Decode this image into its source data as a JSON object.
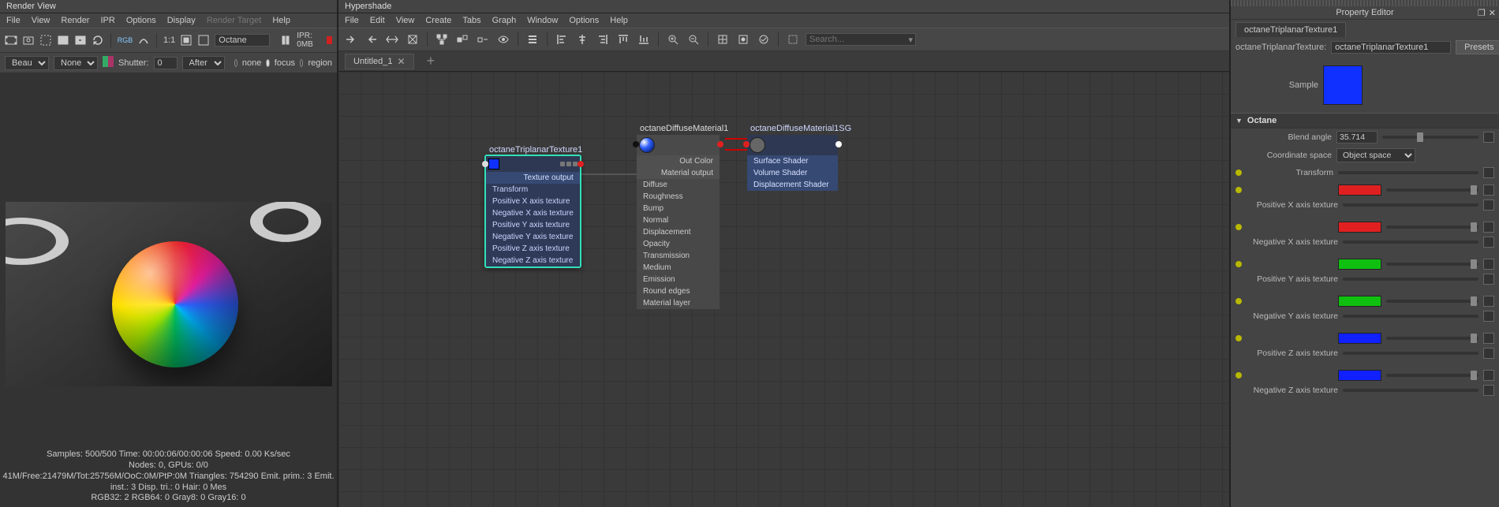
{
  "render_view": {
    "title": "Render View",
    "menus": [
      "File",
      "View",
      "Render",
      "IPR",
      "Options",
      "Display",
      "Render Target",
      "Help"
    ],
    "toolbar": {
      "ratio": "1:1",
      "renderer_field": "Octane",
      "ipr_label": "IPR: 0MB"
    },
    "subbar": {
      "layer_label": "Beauty",
      "camera_label": "None",
      "shutter_label": "Shutter:",
      "shutter_value": "0",
      "time_mode": "After",
      "radios": {
        "none": "none",
        "focus": "focus",
        "region": "region"
      }
    },
    "stats": {
      "l1": "Samples: 500/500  Time: 00:00:06/00:00:06  Speed: 0.00 Ks/sec",
      "l2": "Nodes: 0, GPUs: 0/0",
      "l3": "41M/Free:21479M/Tot:25756M/OoC:0M/PtP:0M Triangles: 754290 Emit. prim.: 3 Emit. inst.: 3 Disp. tri.: 0 Hair: 0 Mes",
      "l4": "RGB32: 2 RGB64: 0 Gray8: 0 Gray16: 0"
    }
  },
  "hypershade": {
    "title": "Hypershade",
    "menus": [
      "File",
      "Edit",
      "View",
      "Create",
      "Tabs",
      "Graph",
      "Window",
      "Options",
      "Help"
    ],
    "search_placeholder": "Search...",
    "tab": "Untitled_1",
    "nodes": {
      "triplanar": {
        "title": "octaneTriplanarTexture1",
        "out": "Texture output",
        "ins": [
          "Transform",
          "Positive X axis texture",
          "Negative X axis texture",
          "Positive Y axis texture",
          "Negative Y axis texture",
          "Positive Z axis texture",
          "Negative Z axis texture"
        ]
      },
      "diffuse": {
        "title": "octaneDiffuseMaterial1",
        "outs": [
          "Out Color",
          "Material output"
        ],
        "ins": [
          "Diffuse",
          "Roughness",
          "Bump",
          "Normal",
          "Displacement",
          "Opacity",
          "Transmission",
          "Medium",
          "Emission",
          "Round edges",
          "Material layer"
        ]
      },
      "sg": {
        "title": "octaneDiffuseMaterial1SG",
        "ins": [
          "Surface Shader",
          "Volume Shader",
          "Displacement Shader"
        ]
      }
    }
  },
  "prop": {
    "title": "Property Editor",
    "tab": "octaneTriplanarTexture1",
    "node_type_label": "octaneTriplanarTexture:",
    "node_name": "octaneTriplanarTexture1",
    "presets": "Presets",
    "sample_label": "Sample",
    "section": "Octane",
    "blend_angle": {
      "label": "Blend angle",
      "value": "35.714",
      "thumb_pct": 36
    },
    "coord_space": {
      "label": "Coordinate space",
      "value": "Object space"
    },
    "transform_label": "Transform",
    "axis": [
      {
        "label": "Positive X axis texture",
        "color": "#e02020"
      },
      {
        "label": "Negative X axis texture",
        "color": "#e02020"
      },
      {
        "label": "Positive Y axis texture",
        "color": "#10c010"
      },
      {
        "label": "Negative Y axis texture",
        "color": "#10c010"
      },
      {
        "label": "Positive Z axis texture",
        "color": "#1020ff"
      },
      {
        "label": "Negative Z axis texture",
        "color": "#1020ff"
      }
    ]
  }
}
